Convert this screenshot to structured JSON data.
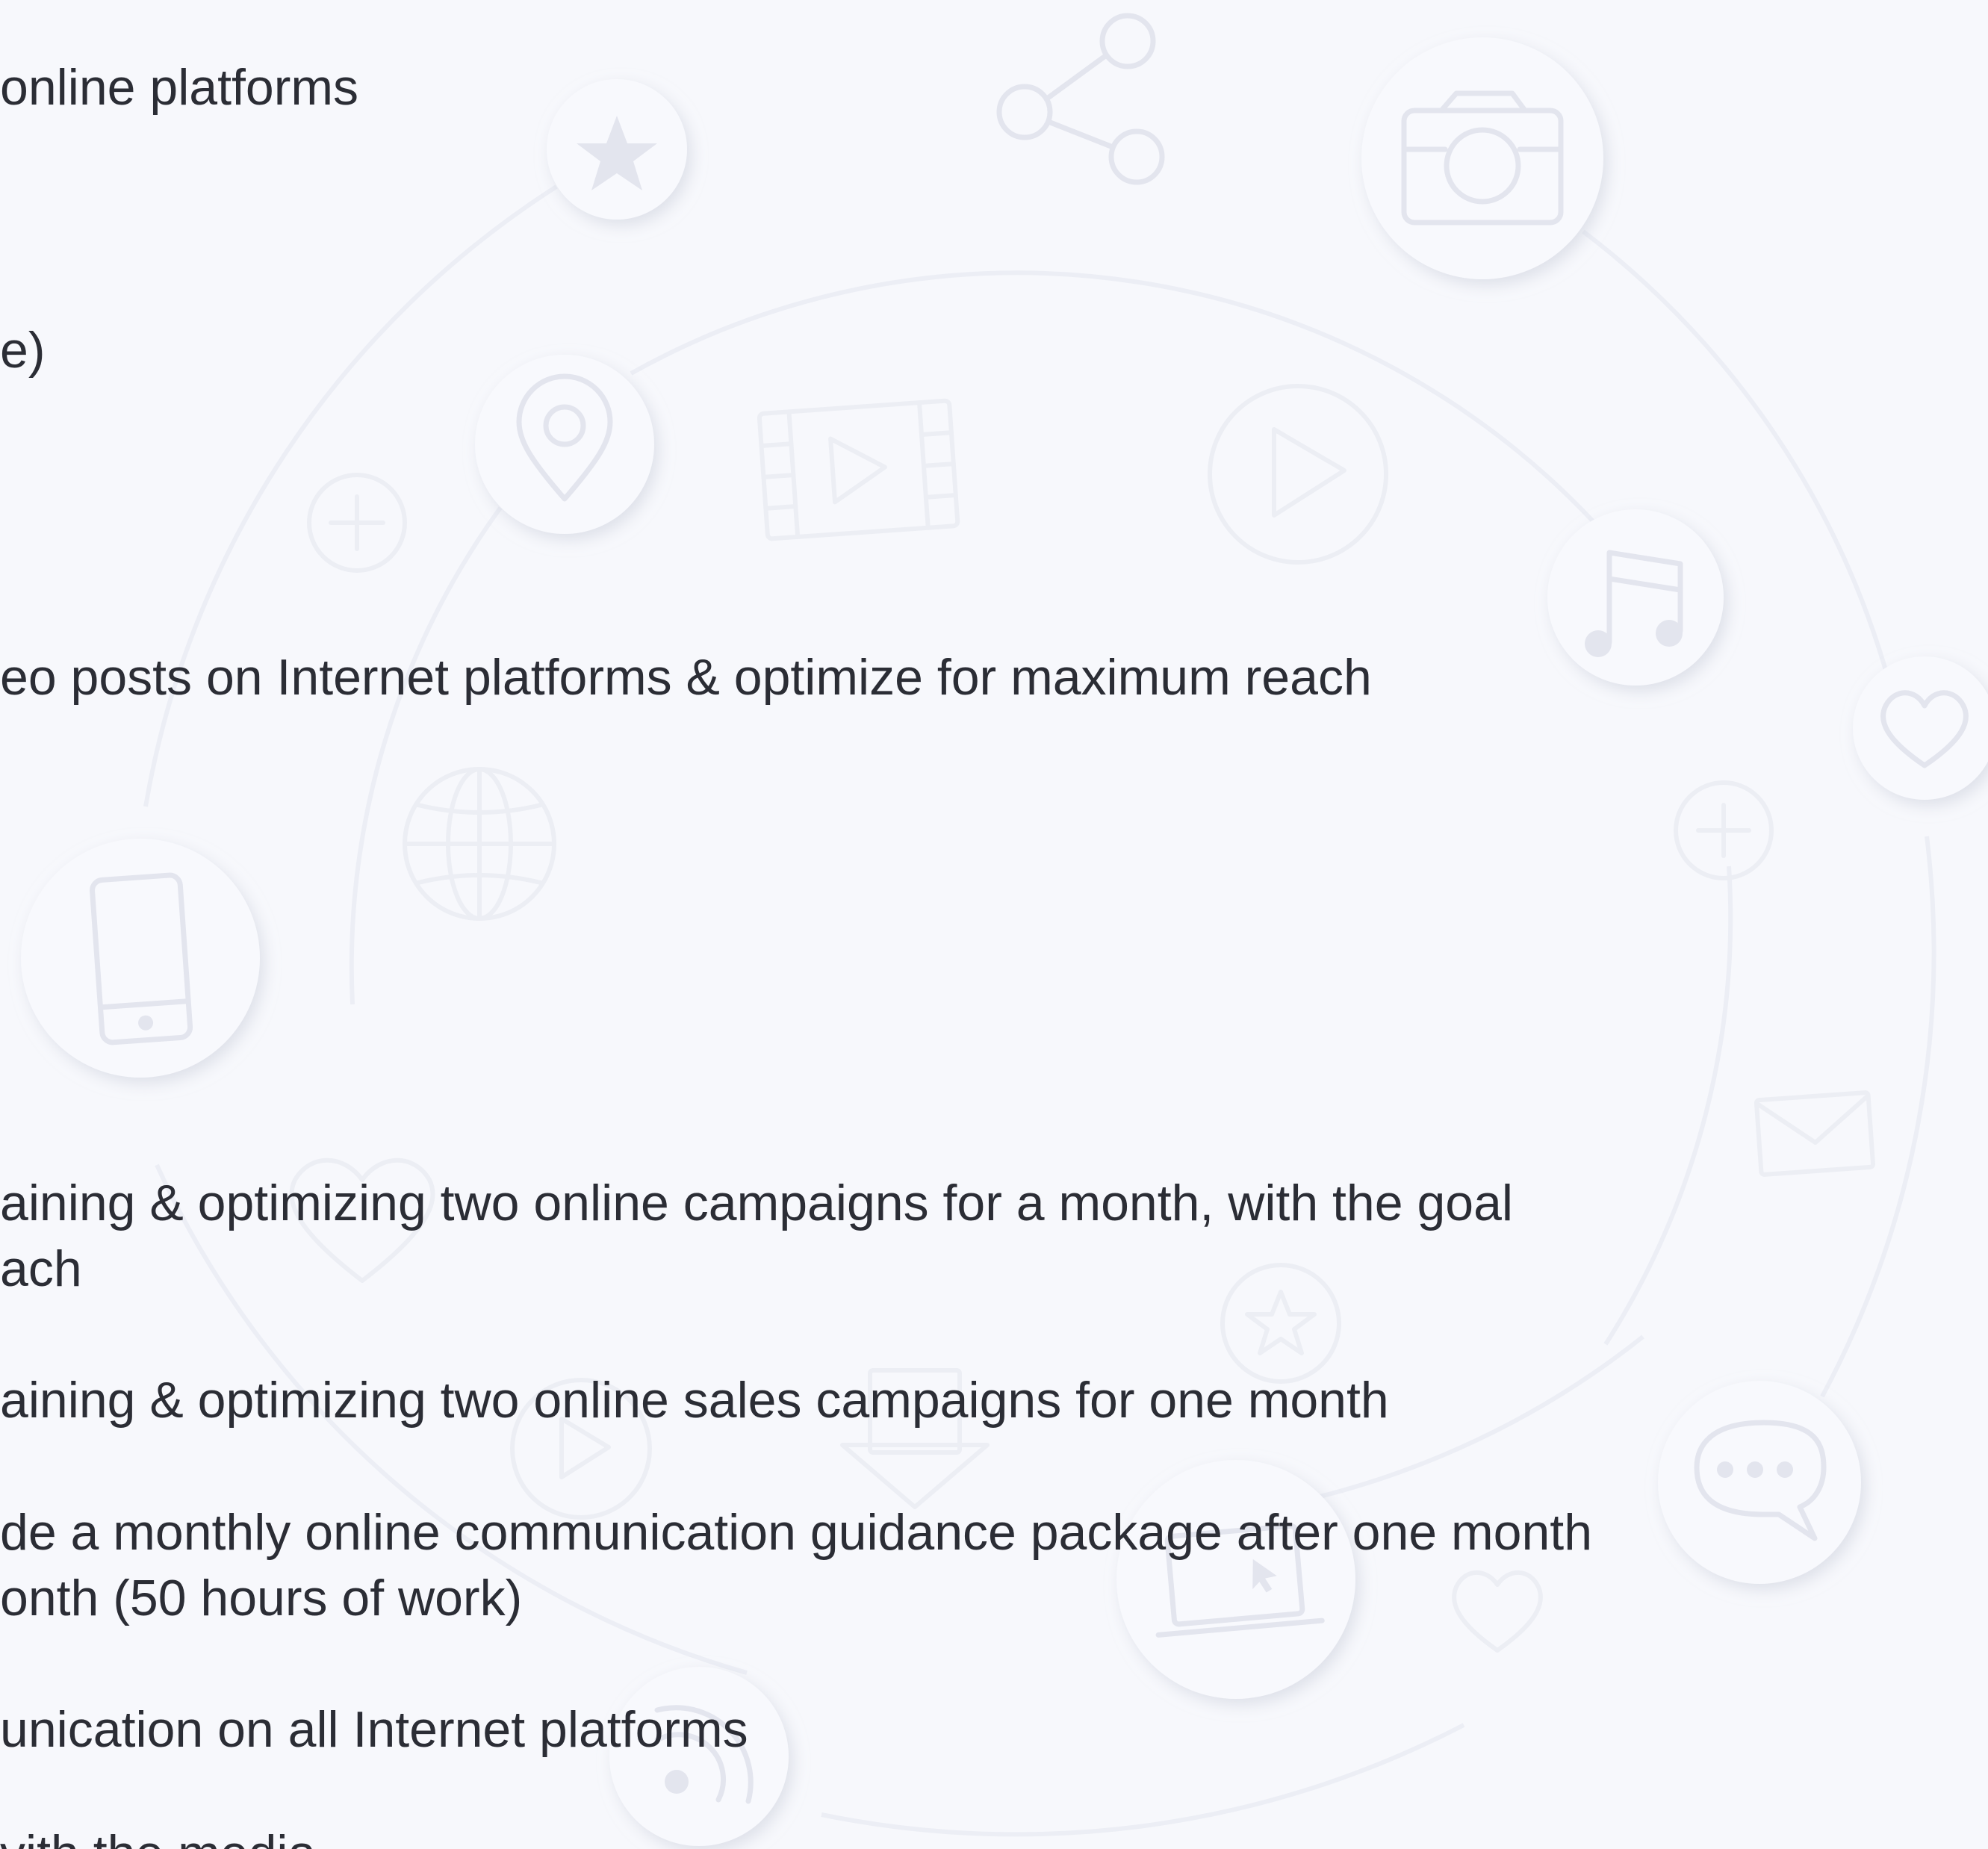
{
  "lines": [
    "online platforms",
    "e)",
    "eo posts on Internet platforms & optimize for maximum reach",
    "aining & optimizing two online campaigns for a month, with the goal",
    "ach",
    "aining & optimizing two online sales campaigns for one month",
    "de a monthly online communication guidance package after one month",
    "onth (50 hours of work)",
    "unication on all Internet platforms",
    "vith the media"
  ],
  "icons": [
    "star-icon",
    "share-icon",
    "camera-icon",
    "location-pin-icon",
    "film-icon",
    "play-icon",
    "music-note-icon",
    "heart-icon",
    "plus-icon",
    "globe-icon",
    "smartphone-icon",
    "envelope-icon",
    "chat-bubble-icon",
    "laptop-icon",
    "rss-icon",
    "download-icon"
  ],
  "colors": {
    "background": "#f7f8fc",
    "text": "#2b2d35",
    "icon_stroke": "#e3e5ee"
  }
}
